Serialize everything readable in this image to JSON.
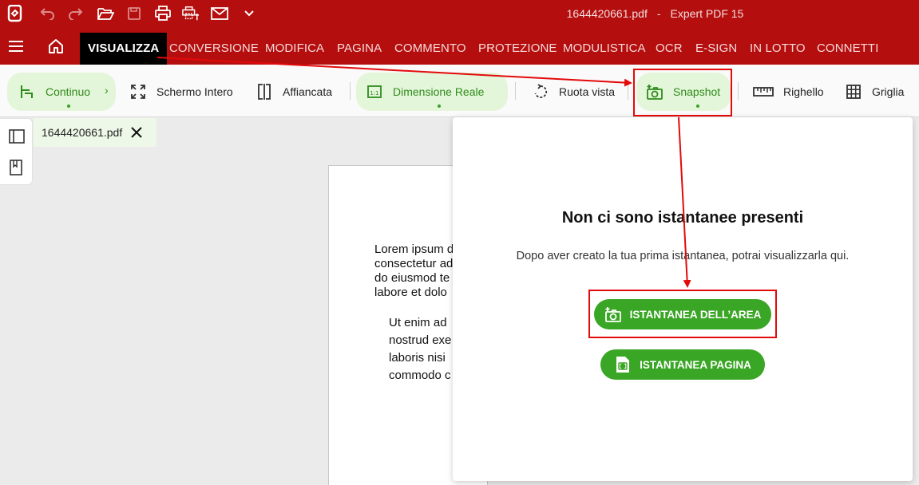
{
  "titlebar": {
    "filename": "1644420661.pdf",
    "separator": "-",
    "app": "Expert PDF 15",
    "quick_access": [
      "app-logo-icon",
      "undo-icon",
      "redo-icon",
      "open-folder-icon",
      "save-icon",
      "print-icon",
      "print-setup-icon",
      "mail-icon",
      "chevron-down-icon"
    ]
  },
  "menubar": {
    "tabs": [
      "VISUALIZZA",
      "CONVERSIONE",
      "MODIFICA",
      "PAGINA",
      "COMMENTO",
      "PROTEZIONE",
      "MODULISTICA",
      "OCR",
      "E-SIGN",
      "IN LOTTO",
      "CONNETTI"
    ],
    "active": "VISUALIZZA"
  },
  "ribbon": {
    "continuo": "Continuo",
    "continuo_chevron": "›",
    "fullscreen": "Schermo Intero",
    "side_by_side": "Affiancata",
    "actual_size": "Dimensione Reale",
    "rotate": "Ruota vista",
    "snapshot": "Snapshot",
    "ruler": "Righello",
    "grid": "Griglia"
  },
  "doc_tab": {
    "name": "1644420661.pdf"
  },
  "document": {
    "para1": "Lorem ipsum d\nconsectetur ad\ndo eiusmod te\nlabore et dolo",
    "para2": "Ut enim ad\nnostrud exe\nlaboris nisi\ncommodo c"
  },
  "snapshot_panel": {
    "title": "Non ci sono istantanee presenti",
    "subtitle": "Dopo aver creato la tua prima istantanea, potrai visualizzarla qui.",
    "area_button": "ISTANTANEA DELL’AREA",
    "page_button": "ISTANTANEA PAGINA"
  },
  "colors": {
    "brand_red": "#b40e0e",
    "accent_green": "#3aa625",
    "pill_green": "#e4f6d9",
    "annotation_red": "#e30a0a"
  }
}
